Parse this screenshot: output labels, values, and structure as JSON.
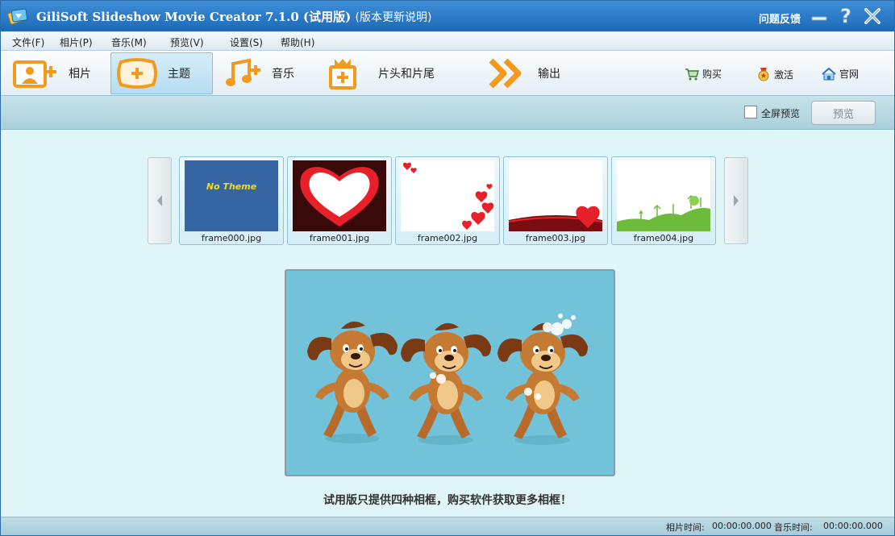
{
  "window": {
    "title": "GiliSoft Slideshow Movie Creator 7.1.0",
    "title_suffix": "(试用版)",
    "title_link": "(版本更新说明)",
    "feedback": "问题反馈"
  },
  "menu": [
    "文件(F)",
    "相片(P)",
    "音乐(M)",
    "预览(V)",
    "设置(S)",
    "帮助(H)"
  ],
  "toolbar": {
    "tools": [
      {
        "label": "相片",
        "icon": "photo-add-icon"
      },
      {
        "label": "主题",
        "icon": "frame-add-icon",
        "active": true
      },
      {
        "label": "音乐",
        "icon": "music-add-icon"
      },
      {
        "label": "片头和片尾",
        "icon": "title-add-icon"
      },
      {
        "label": "输出",
        "icon": "output-arrows-icon"
      }
    ],
    "links": [
      {
        "label": "购买",
        "icon": "cart-icon"
      },
      {
        "label": "激活",
        "icon": "medal-icon"
      },
      {
        "label": "官网",
        "icon": "home-icon"
      }
    ]
  },
  "options": {
    "fullscreen_label": "全屏预览",
    "fullscreen_checked": false,
    "preview_button": "预览"
  },
  "themes": [
    {
      "caption": "frame000.jpg",
      "text": "No Theme"
    },
    {
      "caption": "frame001.jpg"
    },
    {
      "caption": "frame002.jpg"
    },
    {
      "caption": "frame003.jpg"
    },
    {
      "caption": "frame004.jpg"
    }
  ],
  "notice": "试用版只提供四种相框，购买软件获取更多相框！",
  "status": {
    "photo_time_label": "相片时间:",
    "photo_time": "00:00:00.000",
    "music_time_label": "音乐时间:",
    "music_time": "00:00:00.000"
  },
  "colors": {
    "title_bar": "#2a78c8",
    "accent_orange": "#f39a1c",
    "preview_bg": "#72c2da"
  }
}
